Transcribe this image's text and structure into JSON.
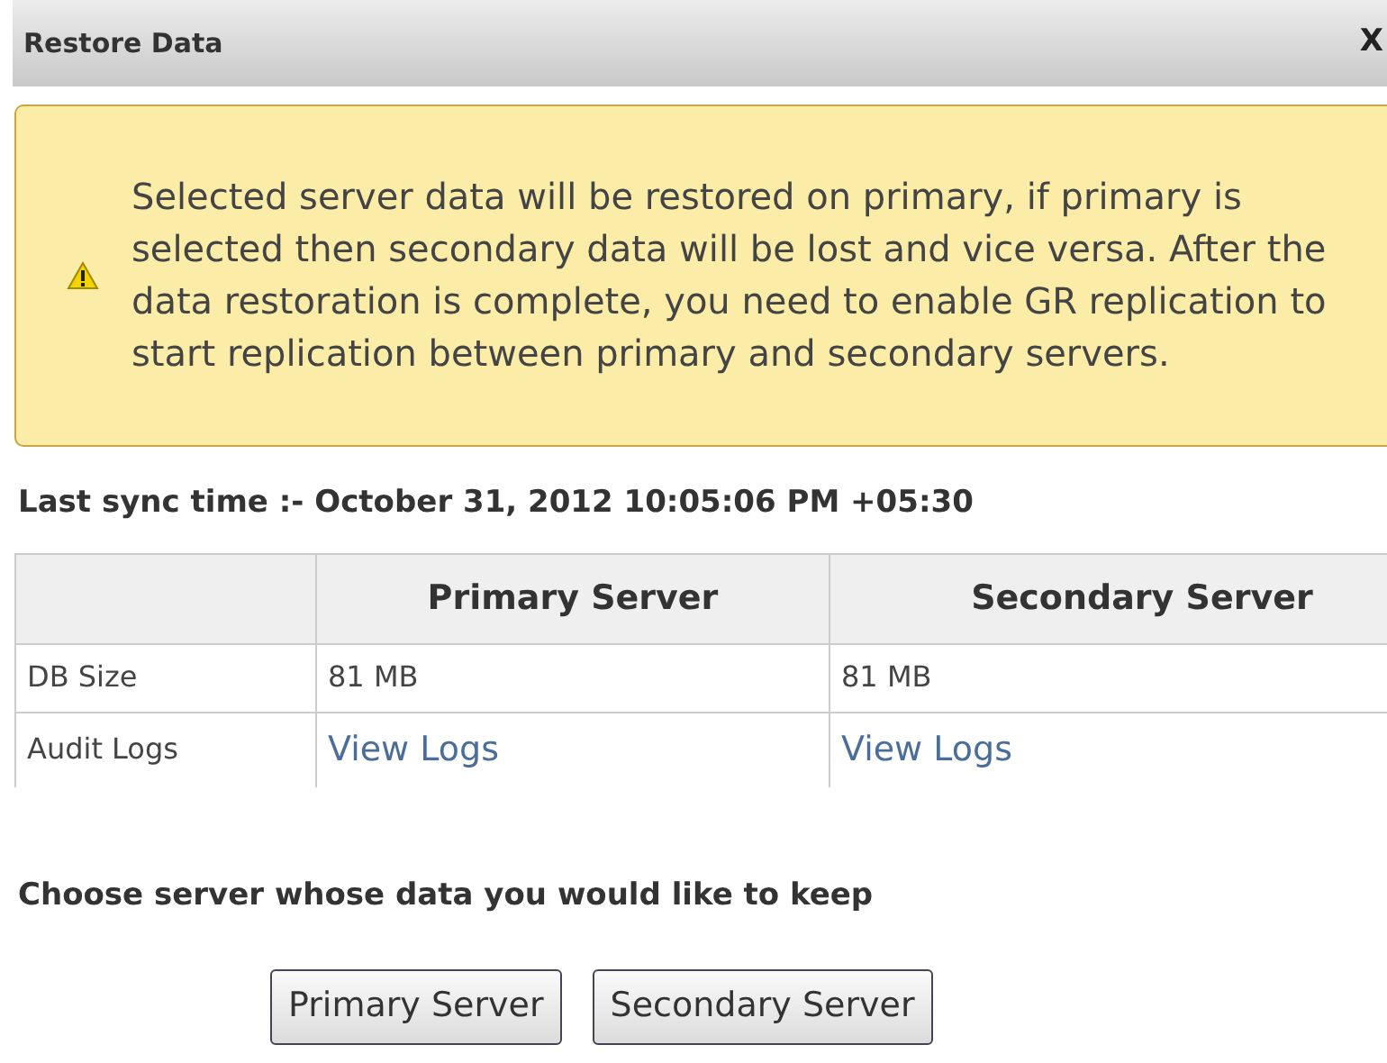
{
  "dialog": {
    "title": "Restore Data",
    "close": "X"
  },
  "warning": "Selected server data will be restored on primary, if primary is selected then secondary data will be lost and vice versa. After the data restoration is complete, you need to enable GR replication to start replication between primary and secondary servers.",
  "last_sync": "Last sync time :- October 31, 2012 10:05:06 PM +05:30",
  "table": {
    "columns": [
      "Primary Server",
      "Secondary Server"
    ],
    "rows": [
      {
        "label": "DB Size",
        "kind": "text",
        "values": [
          "81 MB",
          "81 MB"
        ]
      },
      {
        "label": "Audit Logs",
        "kind": "link",
        "values": [
          "View Logs",
          "View Logs"
        ]
      }
    ]
  },
  "prompt": "Choose server whose data you would like to keep",
  "buttons": [
    "Primary Server",
    "Secondary Server"
  ]
}
